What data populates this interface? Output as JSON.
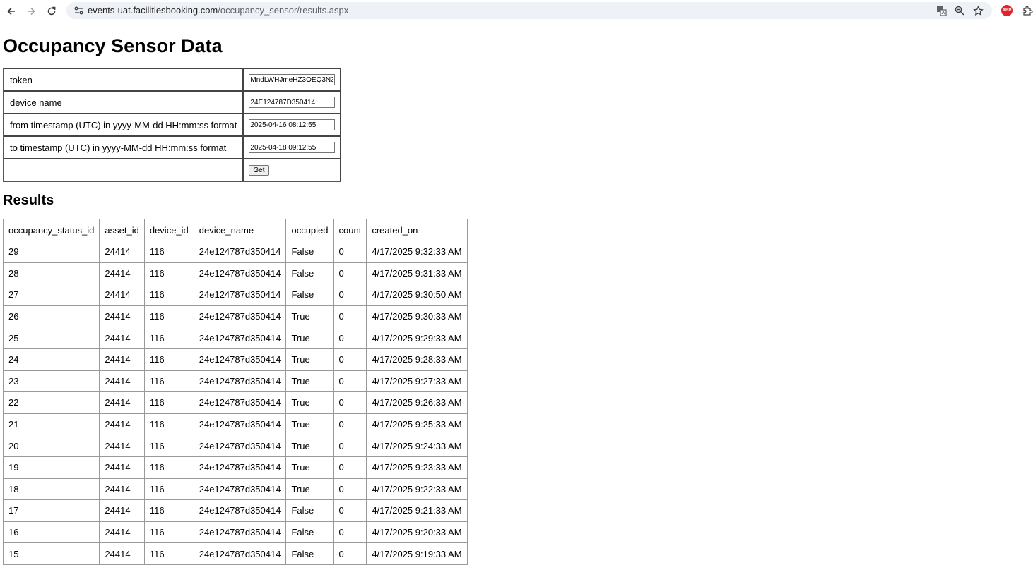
{
  "browser": {
    "url_host": "events-uat.facilitiesbooking.com",
    "url_path": "/occupancy_sensor/results.aspx",
    "abp_label": "ABP"
  },
  "page": {
    "title": "Occupancy Sensor Data",
    "results_heading": "Results"
  },
  "form": {
    "token_label": "token",
    "token_value": "MndLWHJmeHZ3OEQ3N3I",
    "device_label": "device name",
    "device_value": "24E124787D350414",
    "from_label": "from timestamp (UTC) in yyyy-MM-dd HH:mm:ss format",
    "from_value": "2025-04-16 08:12:55",
    "to_label": "to timestamp (UTC) in yyyy-MM-dd HH:mm:ss format",
    "to_value": "2025-04-18 09:12:55",
    "get_label": "Get"
  },
  "results": {
    "columns": [
      "occupancy_status_id",
      "asset_id",
      "device_id",
      "device_name",
      "occupied",
      "count",
      "created_on"
    ],
    "rows": [
      [
        "29",
        "24414",
        "116",
        "24e124787d350414",
        "False",
        "0",
        "4/17/2025 9:32:33 AM"
      ],
      [
        "28",
        "24414",
        "116",
        "24e124787d350414",
        "False",
        "0",
        "4/17/2025 9:31:33 AM"
      ],
      [
        "27",
        "24414",
        "116",
        "24e124787d350414",
        "False",
        "0",
        "4/17/2025 9:30:50 AM"
      ],
      [
        "26",
        "24414",
        "116",
        "24e124787d350414",
        "True",
        "0",
        "4/17/2025 9:30:33 AM"
      ],
      [
        "25",
        "24414",
        "116",
        "24e124787d350414",
        "True",
        "0",
        "4/17/2025 9:29:33 AM"
      ],
      [
        "24",
        "24414",
        "116",
        "24e124787d350414",
        "True",
        "0",
        "4/17/2025 9:28:33 AM"
      ],
      [
        "23",
        "24414",
        "116",
        "24e124787d350414",
        "True",
        "0",
        "4/17/2025 9:27:33 AM"
      ],
      [
        "22",
        "24414",
        "116",
        "24e124787d350414",
        "True",
        "0",
        "4/17/2025 9:26:33 AM"
      ],
      [
        "21",
        "24414",
        "116",
        "24e124787d350414",
        "True",
        "0",
        "4/17/2025 9:25:33 AM"
      ],
      [
        "20",
        "24414",
        "116",
        "24e124787d350414",
        "True",
        "0",
        "4/17/2025 9:24:33 AM"
      ],
      [
        "19",
        "24414",
        "116",
        "24e124787d350414",
        "True",
        "0",
        "4/17/2025 9:23:33 AM"
      ],
      [
        "18",
        "24414",
        "116",
        "24e124787d350414",
        "True",
        "0",
        "4/17/2025 9:22:33 AM"
      ],
      [
        "17",
        "24414",
        "116",
        "24e124787d350414",
        "False",
        "0",
        "4/17/2025 9:21:33 AM"
      ],
      [
        "16",
        "24414",
        "116",
        "24e124787d350414",
        "False",
        "0",
        "4/17/2025 9:20:33 AM"
      ],
      [
        "15",
        "24414",
        "116",
        "24e124787d350414",
        "False",
        "0",
        "4/17/2025 9:19:33 AM"
      ]
    ]
  }
}
